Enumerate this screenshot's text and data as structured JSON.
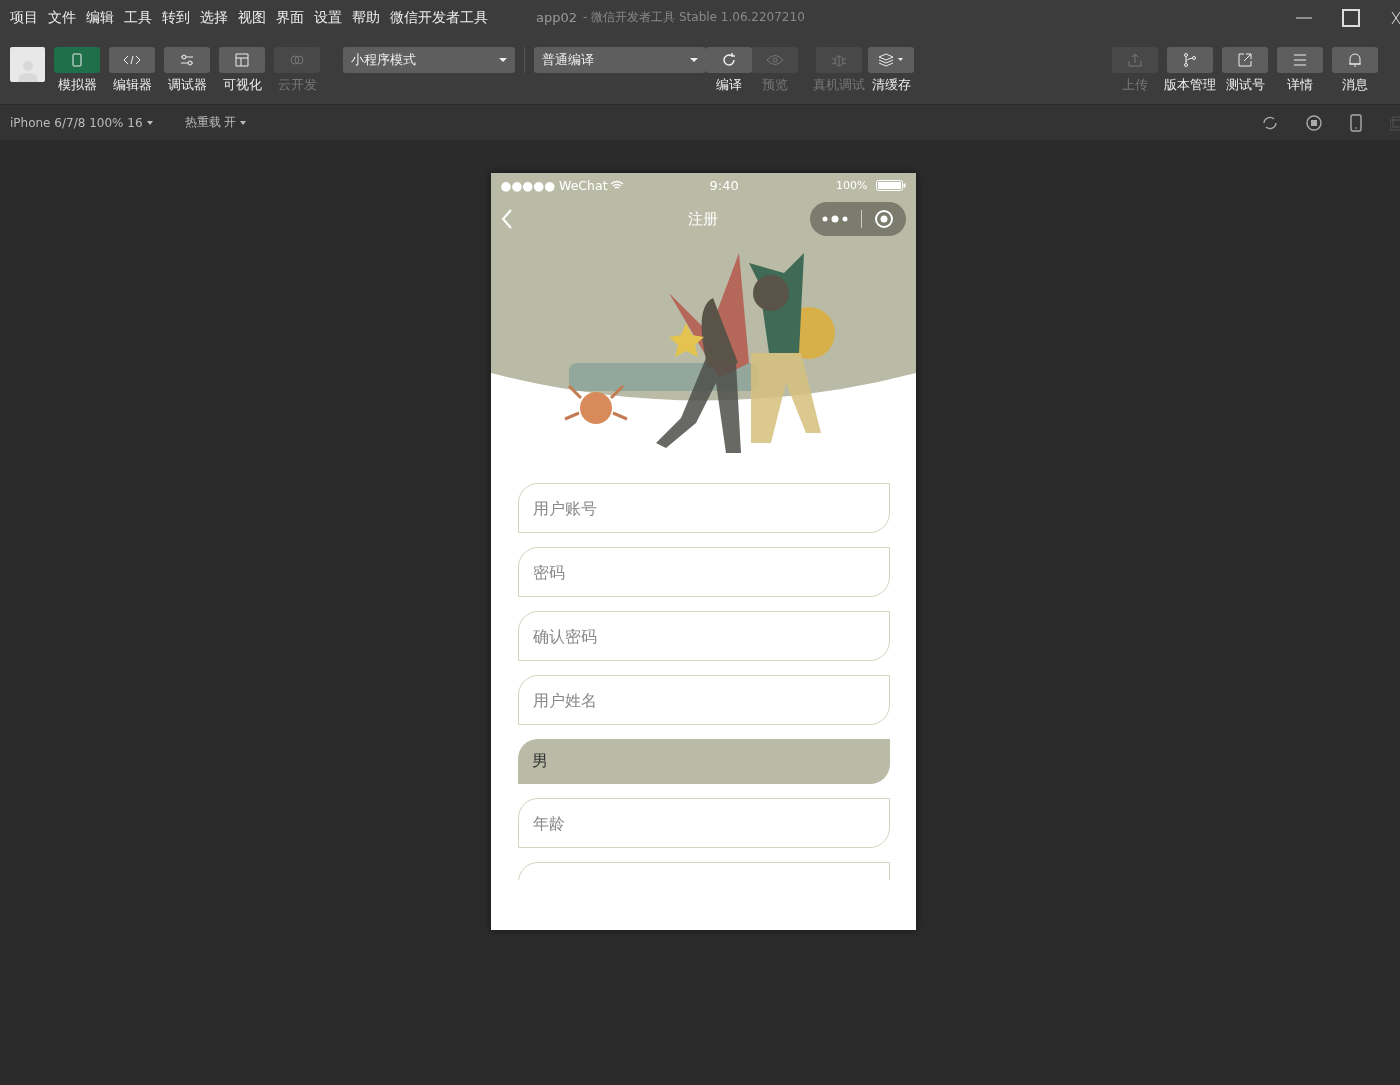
{
  "menu": [
    "项目",
    "文件",
    "编辑",
    "工具",
    "转到",
    "选择",
    "视图",
    "界面",
    "设置",
    "帮助",
    "微信开发者工具"
  ],
  "window": {
    "title": "app02",
    "subtitle": "- 微信开发者工具 Stable 1.06.2207210"
  },
  "left_tools": [
    {
      "label": "模拟器",
      "kind": "phone",
      "selected": true,
      "disabled": false
    },
    {
      "label": "编辑器",
      "kind": "code",
      "selected": false,
      "disabled": false
    },
    {
      "label": "调试器",
      "kind": "sliders",
      "selected": false,
      "disabled": false
    },
    {
      "label": "可视化",
      "kind": "layout",
      "selected": false,
      "disabled": false
    },
    {
      "label": "云开发",
      "kind": "cloud",
      "selected": false,
      "disabled": true
    }
  ],
  "mode_select": {
    "value": "小程序模式"
  },
  "compile_select": {
    "value": "普通编译"
  },
  "compile_tools": [
    {
      "label": "编译",
      "kind": "refresh",
      "disabled": false
    },
    {
      "label": "预览",
      "kind": "eye",
      "disabled": true
    },
    {
      "label": "真机调试",
      "kind": "bug",
      "disabled": true
    },
    {
      "label": "清缓存",
      "kind": "layers",
      "disabled": false
    }
  ],
  "right_tools": [
    {
      "label": "上传",
      "kind": "upload",
      "disabled": true
    },
    {
      "label": "版本管理",
      "kind": "branch",
      "disabled": false
    },
    {
      "label": "测试号",
      "kind": "external",
      "disabled": false
    },
    {
      "label": "详情",
      "kind": "lines",
      "disabled": false
    },
    {
      "label": "消息",
      "kind": "bell",
      "disabled": false
    }
  ],
  "sub_bar": {
    "device": "iPhone 6/7/8 100% 16",
    "hot_reload": "热重载 开"
  },
  "phone": {
    "status_bar": {
      "carrier": "●●●●● WeChat",
      "time": "9:40",
      "battery": "100%"
    },
    "nav_title": "注册",
    "fields": [
      {
        "kind": "input",
        "placeholder": "用户账号"
      },
      {
        "kind": "input",
        "placeholder": "密码"
      },
      {
        "kind": "input",
        "placeholder": "确认密码"
      },
      {
        "kind": "input",
        "placeholder": "用户姓名"
      },
      {
        "kind": "picker",
        "value": "男"
      },
      {
        "kind": "input",
        "placeholder": "年龄"
      },
      {
        "kind": "input"
      }
    ]
  }
}
